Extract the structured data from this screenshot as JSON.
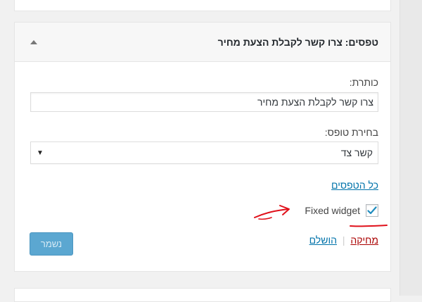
{
  "widget": {
    "header": {
      "type_label": "טפסים:",
      "title": "צרו קשר לקבלת הצעת מחיר",
      "toggle_icon": "triangle-up-icon"
    },
    "title_field": {
      "label": "כותרת:",
      "value": "צרו קשר לקבלת הצעת מחיר"
    },
    "form_select": {
      "label": "בחירת טופס:",
      "selected": "קשר צד",
      "arrow_icon": "dropdown-arrow-icon"
    },
    "all_forms_link": "כל הטפסים",
    "fixed_widget": {
      "label": "Fixed widget",
      "checked": true
    },
    "actions": {
      "delete_label": "מחיקה",
      "separator": "|",
      "close_label": "הושלם",
      "save_label": "נשמר"
    }
  },
  "colors": {
    "link": "#0073aa",
    "delete": "#aa0000",
    "save_button_bg": "#5ba7d1",
    "annotation": "#e0101a",
    "checkmark": "#1e8cbe"
  }
}
